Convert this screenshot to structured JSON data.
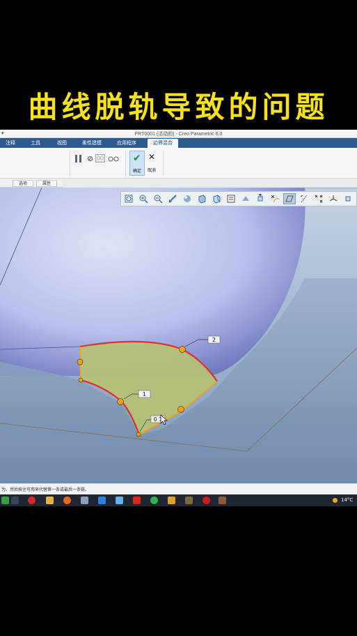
{
  "overlay": {
    "headline": "曲线脱轨导致的问题"
  },
  "window": {
    "title": "PRT0001 (活动的) - Creo Parametric 6.0",
    "quick_access": "▾"
  },
  "tabs": [
    {
      "label": "注释"
    },
    {
      "label": "工具"
    },
    {
      "label": "视图"
    },
    {
      "label": "柔性建模"
    },
    {
      "label": "应用程序"
    },
    {
      "label": "边界混合"
    }
  ],
  "ribbon": {
    "preview_icon_text": "▢▢",
    "ok_label": "确定",
    "cancel_label": "取消"
  },
  "subtabs": [
    {
      "label": "选项"
    },
    {
      "label": "属性"
    }
  ],
  "graphics_toolbar": {
    "icons": [
      "refit-icon",
      "zoom-in-icon",
      "zoom-out-icon",
      "repaint-icon",
      "display-style-icon",
      "saved-views-icon",
      "view-orient-icon",
      "layers-icon",
      "datum-display-icon",
      "spin-center-icon",
      "annotation-display-icon",
      "perspective-icon",
      "plane-display-icon",
      "axis-display-icon",
      "point-display-icon",
      "csys-display-icon",
      "more-icon"
    ],
    "selected_index": 12
  },
  "viewport": {
    "labels": {
      "chain1": "1",
      "chain2": "2",
      "point_label": "0 1"
    }
  },
  "status": {
    "message": "为。然后按住可用来代替第一条或最后一条链。"
  },
  "taskbar": {
    "temperature": "14°C"
  },
  "colors": {
    "headline": "#f7e21a",
    "surface_fill": "#b6c276",
    "boundary_red": "#e0302a",
    "boundary_orange": "#f0a020",
    "tab_bar": "#2b5a8f"
  }
}
